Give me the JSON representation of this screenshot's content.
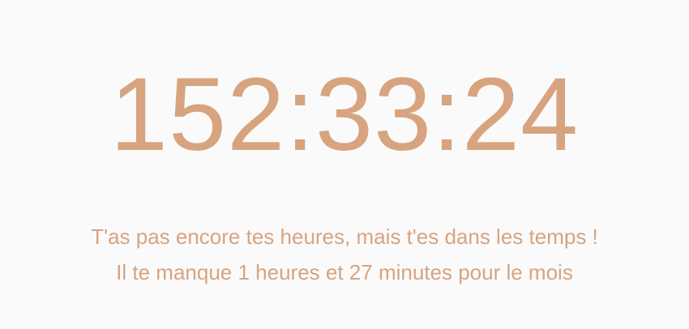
{
  "counter": {
    "elapsed_time": "152:33:24"
  },
  "status": {
    "line1": "T'as pas encore tes heures, mais t'es dans les temps !",
    "line2": "Il te manque 1 heures et 27 minutes pour le mois"
  },
  "colors": {
    "background": "#fafafa",
    "accent": "#d7a47f"
  }
}
